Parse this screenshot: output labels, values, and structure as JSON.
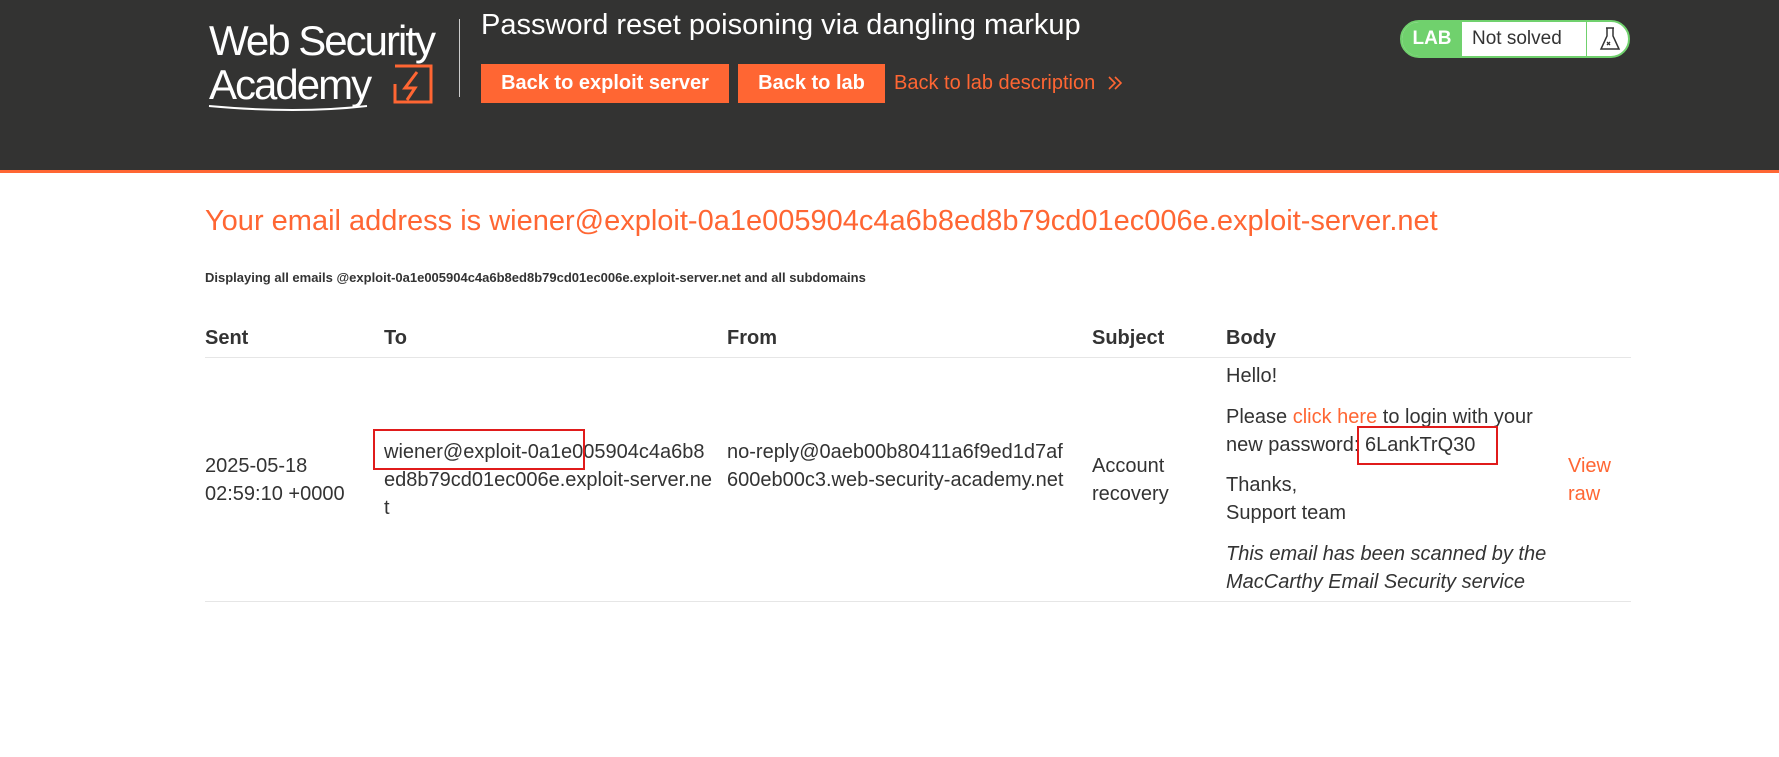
{
  "header": {
    "logo_text": "Web Security Academy",
    "lab_title": "Password reset poisoning via dangling markup",
    "back_to_exploit_server": "Back to exploit server",
    "back_to_lab": "Back to lab",
    "back_to_lab_description": "Back to lab description",
    "status": {
      "badge": "LAB",
      "text": "Not solved",
      "icon": "flask-icon"
    }
  },
  "main": {
    "heading": "Your email address is wiener@exploit-0a1e005904c4a6b8ed8b79cd01ec006e.exploit-server.net",
    "subheading": "Displaying all emails @exploit-0a1e005904c4a6b8ed8b79cd01ec006e.exploit-server.net and all subdomains",
    "table": {
      "columns": [
        "Sent",
        "To",
        "From",
        "Subject",
        "Body"
      ],
      "rows": [
        {
          "sent": "2025-05-18 02:59:10 +0000",
          "to": "wiener@exploit-0a1e005904c4a6b8ed8b79cd01ec006e.exploit-server.net",
          "from": "no-reply@0aeb00b80411a6f9ed1d7af600eb00c3.web-security-academy.net",
          "subject": "Account recovery",
          "body": {
            "hello": "Hello!",
            "please": "Please ",
            "click_here": "click here",
            "login_text": " to login with your new password: ",
            "password": "6LankTrQ30",
            "thanks": "Thanks,",
            "support": "Support team",
            "scanned": "This email has been scanned by the MacCarthy Email Security service"
          },
          "view_raw": "View raw"
        }
      ]
    }
  },
  "colors": {
    "header_bg": "#333332",
    "accent": "#ff6633",
    "status_green": "#70d16d",
    "highlight_red": "#e01b1b"
  }
}
